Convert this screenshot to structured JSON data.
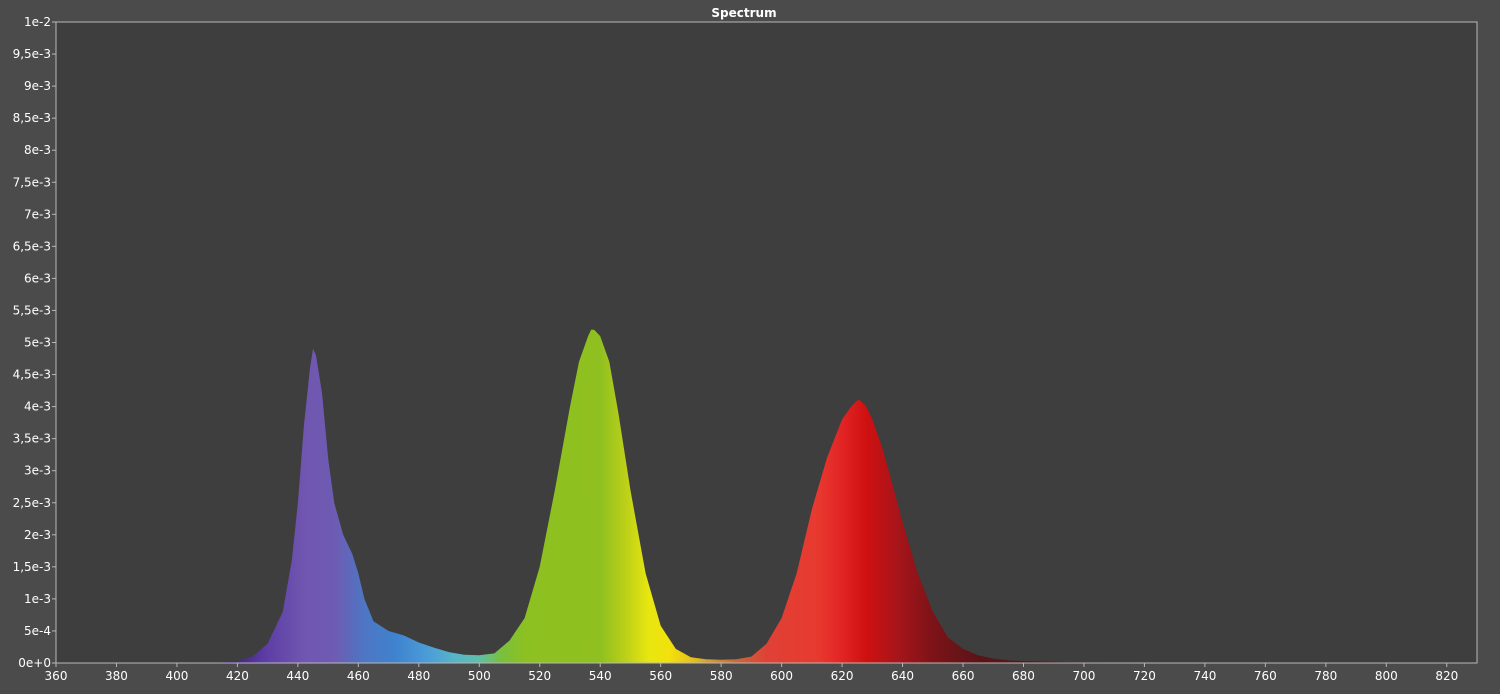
{
  "chart_data": {
    "type": "area",
    "title": "Spectrum",
    "xlabel": "",
    "ylabel": "",
    "xlim": [
      360,
      830
    ],
    "ylim": [
      0,
      0.01
    ],
    "grid": false,
    "legend": "none",
    "x_ticks": [
      360,
      380,
      400,
      420,
      440,
      460,
      480,
      500,
      520,
      540,
      560,
      580,
      600,
      620,
      640,
      660,
      680,
      700,
      720,
      740,
      760,
      780,
      800,
      820
    ],
    "y_ticks": [
      0,
      0.0005,
      0.001,
      0.0015,
      0.002,
      0.0025,
      0.003,
      0.0035,
      0.004,
      0.0045,
      0.005,
      0.0055,
      0.006,
      0.0065,
      0.007,
      0.0075,
      0.008,
      0.0085,
      0.009,
      0.0095,
      0.01
    ],
    "y_tick_labels": [
      "0e+0",
      "5e-4",
      "1e-3",
      "1,5e-3",
      "2e-3",
      "2,5e-3",
      "3e-3",
      "3,5e-3",
      "4e-3",
      "4,5e-3",
      "5e-3",
      "5,5e-3",
      "6e-3",
      "6,5e-3",
      "7e-3",
      "7,5e-3",
      "8e-3",
      "8,5e-3",
      "9e-3",
      "9,5e-3",
      "1e-2"
    ],
    "series": [
      {
        "x": [
          415,
          420,
          425,
          430,
          435,
          438,
          440,
          442,
          444,
          445,
          446,
          448,
          450,
          452,
          455,
          458,
          460,
          462,
          465,
          470,
          475,
          480,
          485,
          490,
          495,
          500,
          505,
          510,
          515,
          520,
          525,
          530,
          533,
          536,
          537,
          538,
          540,
          543,
          546,
          550,
          555,
          560,
          565,
          570,
          575,
          580,
          585,
          590,
          595,
          600,
          605,
          610,
          615,
          620,
          623,
          625,
          626,
          628,
          630,
          633,
          636,
          640,
          645,
          650,
          655,
          660,
          665,
          670,
          675,
          680,
          690,
          700,
          720,
          760,
          800,
          830
        ],
        "values": [
          1e-05,
          3e-05,
          0.0001,
          0.0003,
          0.0008,
          0.0016,
          0.0025,
          0.0037,
          0.0046,
          0.0049,
          0.0048,
          0.0042,
          0.0032,
          0.0025,
          0.002,
          0.0017,
          0.0014,
          0.001,
          0.00065,
          0.0005,
          0.00043,
          0.00032,
          0.00024,
          0.00017,
          0.00013,
          0.00012,
          0.00015,
          0.00035,
          0.0007,
          0.0015,
          0.0027,
          0.004,
          0.0047,
          0.0051,
          0.0052,
          0.0052,
          0.0051,
          0.0047,
          0.0039,
          0.0027,
          0.0014,
          0.00058,
          0.00022,
          9e-05,
          6e-05,
          5e-05,
          6e-05,
          0.0001,
          0.0003,
          0.0007,
          0.0014,
          0.0024,
          0.0032,
          0.0038,
          0.004,
          0.0041,
          0.0041,
          0.004,
          0.0038,
          0.0034,
          0.0029,
          0.0022,
          0.0014,
          0.0008,
          0.0004,
          0.00022,
          0.00012,
          7e-05,
          4e-05,
          3e-05,
          2e-05,
          1e-05,
          5e-06,
          0,
          0,
          0
        ]
      }
    ]
  },
  "colors": {
    "frame_background": "#4b4b4b",
    "plot_background": "#3e3e3e",
    "plot_border": "#b8b8b8",
    "tick_text": "#ffffff",
    "title_text": "#ffffff"
  },
  "spectrum_gradient": [
    {
      "nm": 415,
      "color": "#3a1a78"
    },
    {
      "nm": 430,
      "color": "#5e3fa6"
    },
    {
      "nm": 442,
      "color": "#7056b0"
    },
    {
      "nm": 452,
      "color": "#6e5bb2"
    },
    {
      "nm": 462,
      "color": "#4e76c4"
    },
    {
      "nm": 472,
      "color": "#3f82ce"
    },
    {
      "nm": 482,
      "color": "#4a9ad8"
    },
    {
      "nm": 492,
      "color": "#56b5c8"
    },
    {
      "nm": 500,
      "color": "#5fbfa8"
    },
    {
      "nm": 507,
      "color": "#78c040"
    },
    {
      "nm": 515,
      "color": "#8dc021"
    },
    {
      "nm": 540,
      "color": "#8fc020"
    },
    {
      "nm": 548,
      "color": "#b9cf18"
    },
    {
      "nm": 556,
      "color": "#e8e610"
    },
    {
      "nm": 563,
      "color": "#f3e10c"
    },
    {
      "nm": 570,
      "color": "#e6c21a"
    },
    {
      "nm": 578,
      "color": "#c99438"
    },
    {
      "nm": 585,
      "color": "#c66a3a"
    },
    {
      "nm": 595,
      "color": "#e04136"
    },
    {
      "nm": 612,
      "color": "#e8392f"
    },
    {
      "nm": 620,
      "color": "#e22424"
    },
    {
      "nm": 628,
      "color": "#cf1011"
    },
    {
      "nm": 638,
      "color": "#a8151a"
    },
    {
      "nm": 650,
      "color": "#7c1318"
    },
    {
      "nm": 665,
      "color": "#5a1418"
    },
    {
      "nm": 700,
      "color": "#3e2023"
    }
  ]
}
